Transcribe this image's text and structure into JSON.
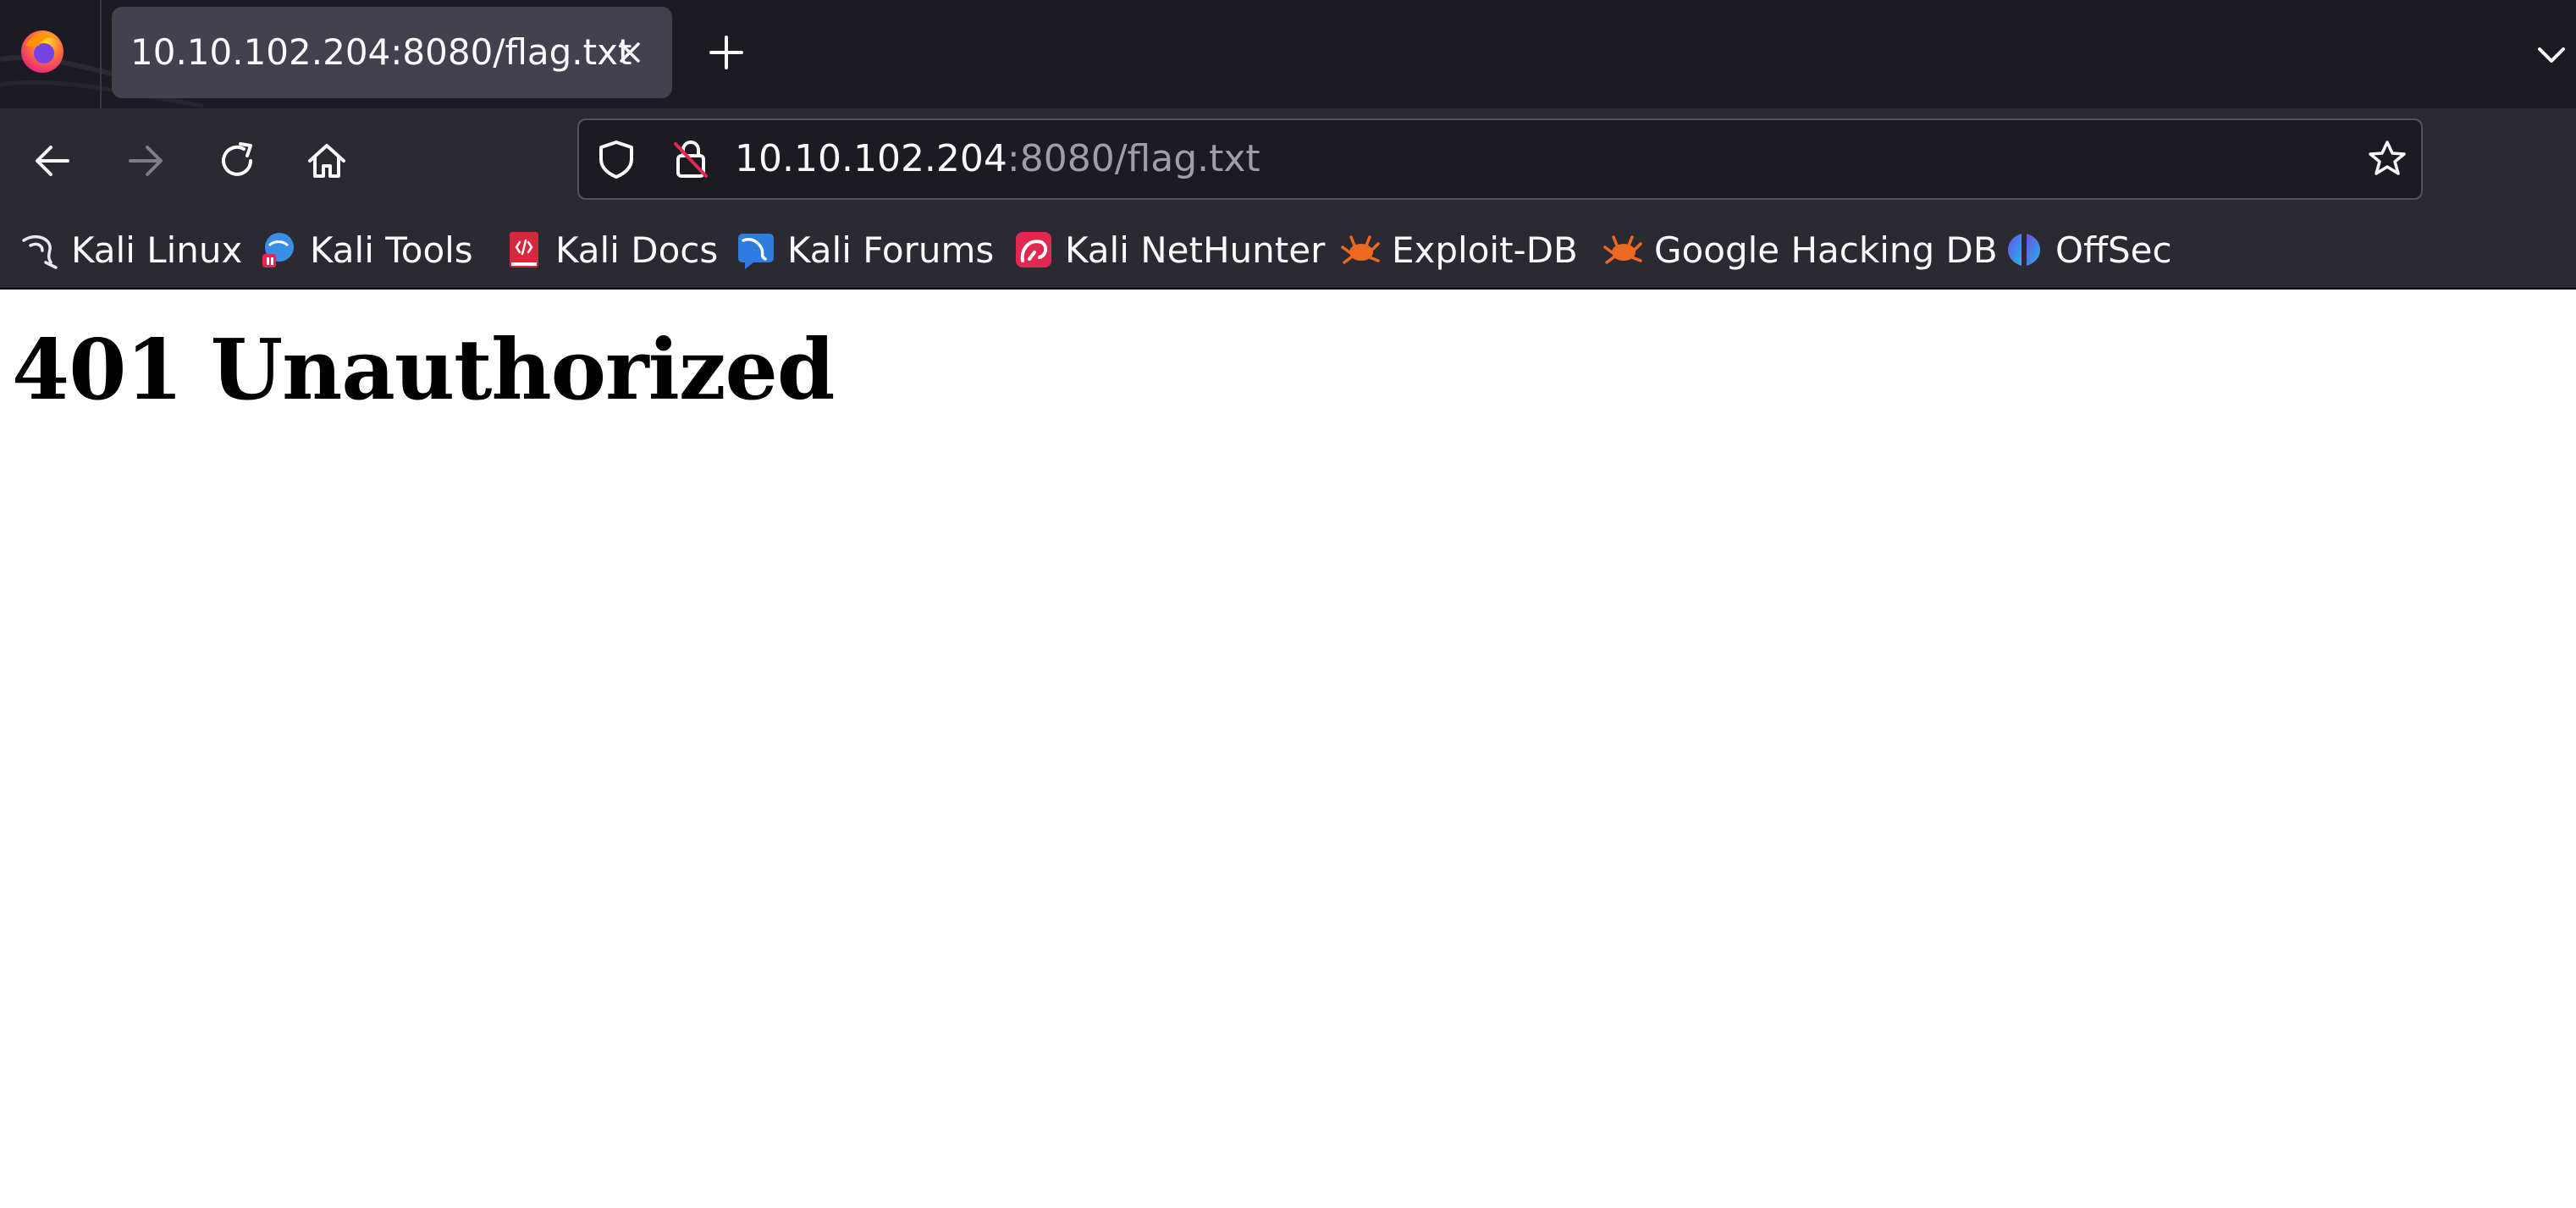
{
  "browser": {
    "tab": {
      "title": "10.10.102.204:8080/flag.txt"
    },
    "urlbar": {
      "host": "10.10.102.204",
      "path": ":8080/flag.txt"
    },
    "icons": {
      "app": "firefox-icon",
      "tab_close": "close-icon",
      "new_tab": "plus-icon",
      "tab_list": "chevron-down-icon",
      "back": "back-arrow-icon",
      "forward": "forward-arrow-icon",
      "reload": "reload-icon",
      "home": "home-icon",
      "shield": "shield-icon",
      "insecure_lock": "lock-slash-icon",
      "bookmark_star": "star-icon"
    },
    "colors": {
      "tabstrip_bg": "#1c1b22",
      "toolbar_bg": "#2b2a33",
      "active_tab_bg": "#42414d",
      "url_host": "#fbfbfe",
      "url_path": "#9e9ea6"
    }
  },
  "bookmarks": [
    {
      "label": "Kali Linux",
      "icon": "kali-dragon-icon"
    },
    {
      "label": "Kali Tools",
      "icon": "kali-tools-icon"
    },
    {
      "label": "Kali Docs",
      "icon": "kali-docs-icon"
    },
    {
      "label": "Kali Forums",
      "icon": "kali-forums-icon"
    },
    {
      "label": "Kali NetHunter",
      "icon": "nethunter-icon"
    },
    {
      "label": "Exploit-DB",
      "icon": "exploit-db-icon"
    },
    {
      "label": "Google Hacking DB",
      "icon": "exploit-db-icon"
    },
    {
      "label": "OffSec",
      "icon": "offsec-icon"
    }
  ],
  "page": {
    "heading": "401 Unauthorized"
  }
}
